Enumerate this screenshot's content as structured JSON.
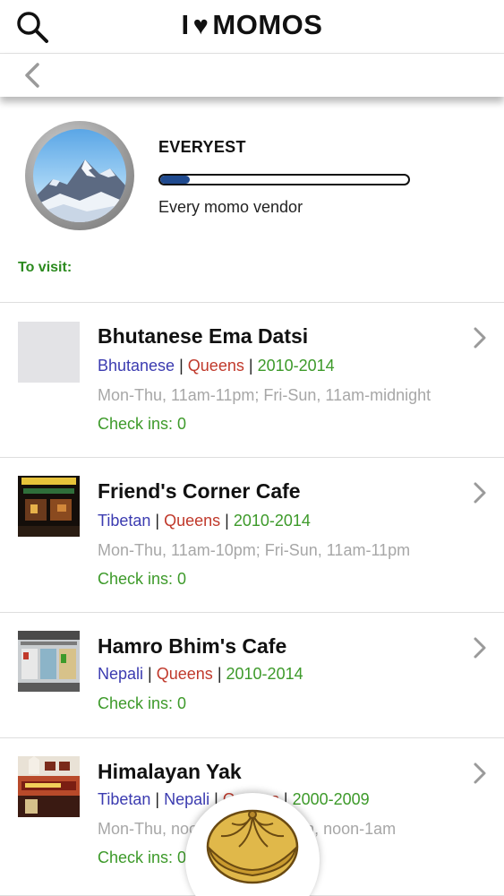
{
  "header": {
    "title_left": "I",
    "title_heart": "♥",
    "title_right": "MOMOS"
  },
  "badge": {
    "name": "EVERYEST",
    "progress_fraction": 0.12,
    "description": "Every momo vendor"
  },
  "list_heading": "To visit:",
  "vendors": [
    {
      "name": "Bhutanese Ema Datsi",
      "cuisine": "Bhutanese",
      "borough": "Queens",
      "years": "2010-2014",
      "hours": "Mon-Thu, 11am-11pm; Fri-Sun, 11am-midnight",
      "checkins": "Check ins: 0"
    },
    {
      "name": "Friend's Corner Cafe",
      "cuisine": "Tibetan",
      "borough": "Queens",
      "years": "2010-2014",
      "hours": "Mon-Thu, 11am-10pm; Fri-Sun, 11am-11pm",
      "checkins": "Check ins: 0"
    },
    {
      "name": "Hamro Bhim's Cafe",
      "cuisine": "Nepali",
      "borough": "Queens",
      "years": "2010-2014",
      "checkins": "Check ins: 0"
    },
    {
      "name": "Himalayan Yak",
      "cuisine": "Tibetan",
      "cuisine2": "Nepali",
      "borough": "Queens",
      "years": "2000-2009",
      "hours_start": "Mon-Thu, noo",
      "hours_end": "n, noon-1am",
      "checkins": "Check ins: 0"
    }
  ],
  "separator": "|",
  "colors": {
    "cuisine": "#3b3bb0",
    "borough": "#c0392b",
    "years": "#3d9a2a",
    "hours": "#a7a7a7",
    "checkins": "#3d9a2a",
    "progress": "#1f4a8f"
  },
  "icons": {
    "search": "search-icon",
    "back": "chevron-left-icon",
    "row_arrow": "chevron-right-icon",
    "fab": "momo-dumpling-icon"
  }
}
